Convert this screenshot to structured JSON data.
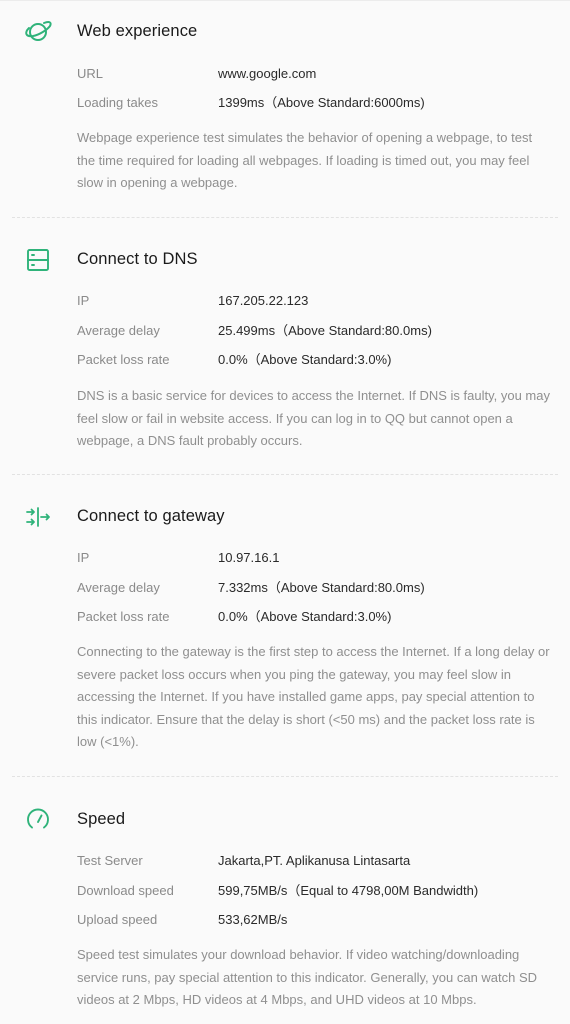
{
  "accent": "#2fb37a",
  "sections": [
    {
      "title": "Web experience",
      "icon": "planet-icon",
      "rows": [
        {
          "label": "URL",
          "value": "www.google.com"
        },
        {
          "label": "Loading takes",
          "value": "1399ms（Above Standard:6000ms)"
        }
      ],
      "description": "Webpage experience test simulates the behavior of opening a webpage, to test the time required for loading all webpages. If loading is timed out, you may feel slow in opening a webpage."
    },
    {
      "title": "Connect to DNS",
      "icon": "server-icon",
      "rows": [
        {
          "label": "IP",
          "value": "167.205.22.123"
        },
        {
          "label": "Average delay",
          "value": "25.499ms（Above Standard:80.0ms)"
        },
        {
          "label": "Packet loss rate",
          "value": "0.0%（Above Standard:3.0%)"
        }
      ],
      "description": "DNS is a basic service for devices to access the Internet. If DNS is faulty, you may feel slow or fail in website access. If you can log in to QQ but cannot open a webpage, a DNS fault probably occurs."
    },
    {
      "title": "Connect to gateway",
      "icon": "gateway-arrows-icon",
      "rows": [
        {
          "label": "IP",
          "value": "10.97.16.1"
        },
        {
          "label": "Average delay",
          "value": "7.332ms（Above Standard:80.0ms)"
        },
        {
          "label": "Packet loss rate",
          "value": "0.0%（Above Standard:3.0%)"
        }
      ],
      "description": "Connecting to the gateway is the first step to access the Internet. If a long delay or severe packet loss occurs when you ping the gateway, you may feel slow in accessing the Internet. If you have installed game apps, pay special attention to this indicator. Ensure that the delay is short (<50 ms) and the packet loss rate is low (<1%)."
    },
    {
      "title": "Speed",
      "icon": "speedometer-icon",
      "rows": [
        {
          "label": "Test Server",
          "value": "Jakarta,PT. Aplikanusa Lintasarta"
        },
        {
          "label": "Download speed",
          "value": "599,75MB/s（Equal to 4798,00M Bandwidth)"
        },
        {
          "label": "Upload speed",
          "value": "533,62MB/s"
        }
      ],
      "description": "Speed test simulates your download behavior. If video watching/downloading service runs, pay special attention to this indicator. Generally, you can watch SD videos at 2 Mbps, HD videos at 4 Mbps, and UHD videos at 10 Mbps."
    }
  ]
}
